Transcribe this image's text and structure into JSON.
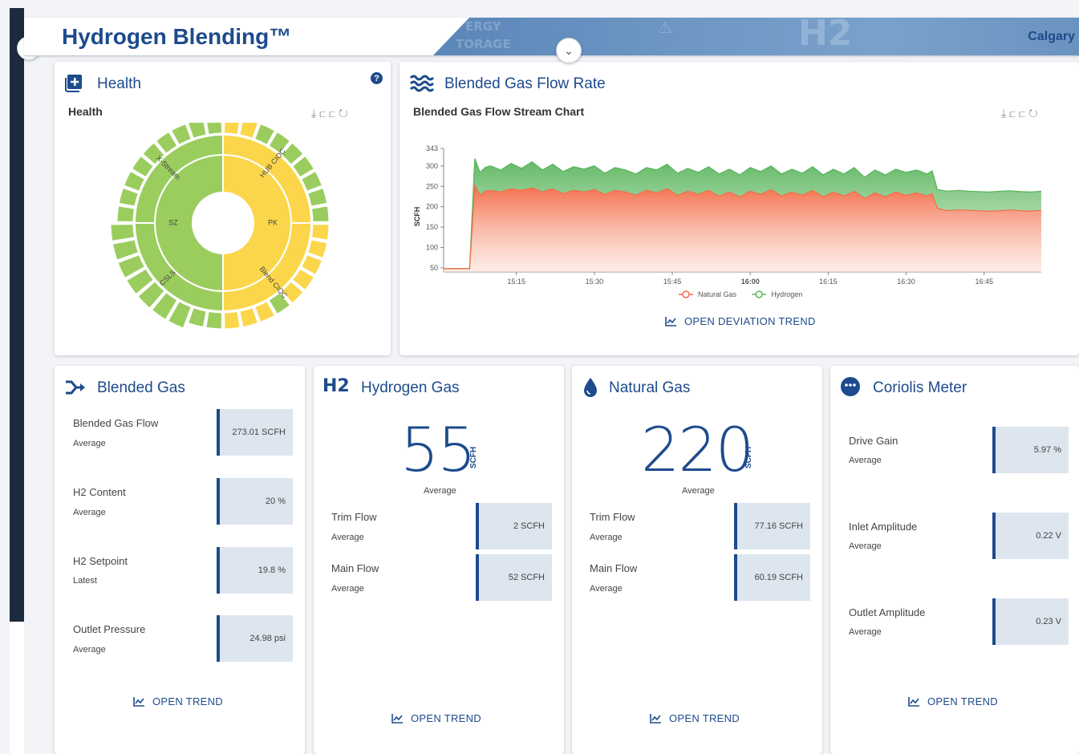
{
  "header": {
    "title": "Hydrogen Blending™",
    "location": "Calgary"
  },
  "health": {
    "card_title": "Health",
    "subtitle": "Health",
    "help": "?",
    "segments": {
      "x_stream": "X-Stream",
      "hub_cioc": "HUB CIOC",
      "pk": "PK",
      "sz": "SZ",
      "csls": "CSLS",
      "blend_cioc": "Blend CIOC"
    }
  },
  "flow": {
    "card_title": "Blended Gas Flow Rate",
    "subtitle": "Blended Gas Flow Stream Chart",
    "open_label": "OPEN DEVIATION TREND"
  },
  "chart_data": {
    "type": "area",
    "ylabel": "SCFH",
    "y_ticks": [
      50,
      100,
      150,
      200,
      250,
      300,
      343
    ],
    "ylim": [
      40,
      343
    ],
    "x_ticks": [
      "15:15",
      "15:30",
      "15:45",
      "16:00",
      "16:15",
      "16:30",
      "16:45"
    ],
    "x_tick_minutes": [
      15,
      30,
      45,
      60,
      75,
      90,
      105
    ],
    "x_range_minutes": [
      1,
      116
    ],
    "x": [
      1,
      5,
      6,
      7,
      8,
      9,
      10,
      12,
      14,
      16,
      18,
      20,
      22,
      24,
      26,
      28,
      30,
      32,
      34,
      36,
      38,
      40,
      42,
      44,
      46,
      48,
      50,
      52,
      54,
      56,
      58,
      60,
      62,
      64,
      66,
      68,
      70,
      72,
      74,
      76,
      78,
      80,
      82,
      84,
      86,
      88,
      90,
      92,
      94,
      95,
      96,
      98,
      100,
      102,
      104,
      106,
      108,
      110,
      112,
      114,
      116
    ],
    "legend": [
      "Natural Gas",
      "Hydrogen"
    ],
    "legend_position": "bottom",
    "series": [
      {
        "name": "Natural Gas",
        "color": "#f36f4c",
        "values": [
          48,
          48,
          48,
          252,
          228,
          238,
          240,
          236,
          244,
          240,
          246,
          236,
          244,
          232,
          240,
          236,
          242,
          230,
          240,
          236,
          228,
          240,
          234,
          244,
          228,
          238,
          230,
          240,
          226,
          236,
          224,
          238,
          230,
          242,
          226,
          236,
          228,
          240,
          224,
          236,
          226,
          238,
          220,
          234,
          224,
          236,
          228,
          234,
          226,
          232,
          196,
          190,
          192,
          191,
          190,
          189,
          190,
          192,
          190,
          189,
          191
        ]
      },
      {
        "name": "Hydrogen",
        "color": "#5ab55e",
        "values": [
          48,
          48,
          48,
          318,
          284,
          296,
          300,
          290,
          306,
          294,
          310,
          290,
          304,
          286,
          298,
          292,
          300,
          282,
          296,
          290,
          280,
          296,
          290,
          304,
          282,
          294,
          284,
          298,
          280,
          292,
          278,
          296,
          286,
          300,
          280,
          292,
          282,
          298,
          278,
          292,
          280,
          296,
          272,
          290,
          278,
          292,
          284,
          290,
          280,
          288,
          242,
          238,
          240,
          238,
          237,
          236,
          238,
          239,
          237,
          236,
          238
        ]
      }
    ]
  },
  "blended": {
    "card_title": "Blended Gas",
    "metrics": [
      {
        "label": "Blended Gas Flow",
        "sub": "Average",
        "value": "273.01 SCFH"
      },
      {
        "label": "H2 Content",
        "sub": "Average",
        "value": "20 %"
      },
      {
        "label": "H2 Setpoint",
        "sub": "Latest",
        "value": "19.8 %"
      },
      {
        "label": "Outlet Pressure",
        "sub": "Average",
        "value": "24.98 psi"
      }
    ],
    "open_label": "OPEN TREND"
  },
  "hydrogen": {
    "card_title": "Hydrogen Gas",
    "icon_text": "H2",
    "big_value": "55",
    "big_unit": "SCFH",
    "big_sub": "Average",
    "metrics": [
      {
        "label": "Trim Flow",
        "sub": "Average",
        "value": "2 SCFH"
      },
      {
        "label": "Main Flow",
        "sub": "Average",
        "value": "52 SCFH"
      }
    ],
    "open_label": "OPEN TREND"
  },
  "natural": {
    "card_title": "Natural Gas",
    "big_value": "220",
    "big_unit": "SCFH",
    "big_sub": "Average",
    "metrics": [
      {
        "label": "Trim Flow",
        "sub": "Average",
        "value": "77.16 SCFH"
      },
      {
        "label": "Main Flow",
        "sub": "Average",
        "value": "60.19 SCFH"
      }
    ],
    "open_label": "OPEN TREND"
  },
  "coriolis": {
    "card_title": "Coriolis Meter",
    "metrics": [
      {
        "label": "Drive Gain",
        "sub": "Average",
        "value": "5.97 %"
      },
      {
        "label": "Inlet Amplitude",
        "sub": "Average",
        "value": "0.22 V"
      },
      {
        "label": "Outlet Amplitude",
        "sub": "Average",
        "value": "0.23 V"
      }
    ],
    "open_label": "OPEN TREND"
  }
}
